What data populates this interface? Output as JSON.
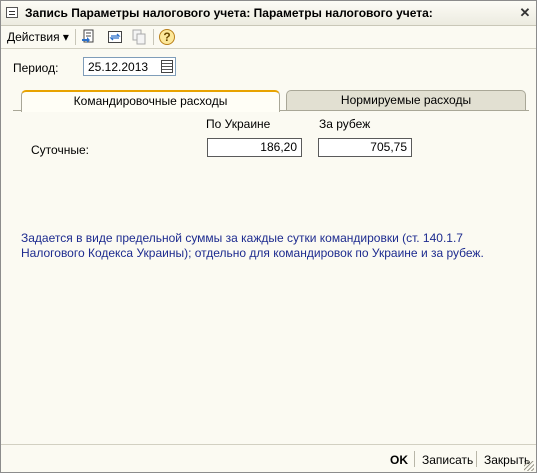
{
  "window": {
    "title": "Запись Параметры налогового учета: Параметры налогового учета:",
    "close_glyph": "✕"
  },
  "toolbar": {
    "actions_label": "Действия",
    "actions_arrow": "▾",
    "help_glyph": "?"
  },
  "period": {
    "label": "Период:",
    "value": "25.12.2013"
  },
  "tabs": [
    {
      "label": "Командировочные расходы",
      "active": true
    },
    {
      "label": "Нормируемые расходы",
      "active": false
    }
  ],
  "per_diem": {
    "col_ukraine": "По Украине",
    "col_abroad": "За рубеж",
    "row_label": "Суточные:",
    "ukraine_value": "186,20",
    "abroad_value": "705,75"
  },
  "note": "Задается в виде предельной суммы за каждые сутки командировки (ст. 140.1.7 Налогового Кодекса Украины); отдельно для командировок по Украине и за рубеж.",
  "buttons": {
    "ok": "OK",
    "save": "Записать",
    "close": "Закрыть"
  },
  "colors": {
    "note_text": "#1d2b8f",
    "active_tab_accent": "#e8a300"
  }
}
